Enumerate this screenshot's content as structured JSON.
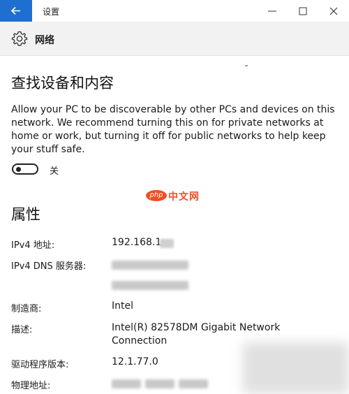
{
  "window": {
    "title": "设置",
    "back_icon": "arrow-left-icon",
    "accent": "#1f6fd1"
  },
  "header": {
    "icon": "gear-icon",
    "title": "网络"
  },
  "discovery": {
    "heading": "查找设备和内容",
    "description": "Allow your PC to be discoverable by other PCs and devices on this network. We recommend turning this on for private networks at home or work, but turning it off for public networks to help keep your stuff safe.",
    "toggle_state": "关"
  },
  "watermark": {
    "logo": "php",
    "text": "中文网"
  },
  "properties": {
    "heading": "属性",
    "ipv4_label": "IPv4 地址:",
    "ipv4_value": "192.168.1",
    "dns_label": "IPv4 DNS 服务器:",
    "manufacturer_label": "制造商:",
    "manufacturer_value": "Intel",
    "description_label": "描述:",
    "description_value": "Intel(R) 82578DM Gigabit Network Connection",
    "driver_label": "驱动程序版本:",
    "driver_value": "12.1.77.0",
    "mac_label": "物理地址:"
  }
}
